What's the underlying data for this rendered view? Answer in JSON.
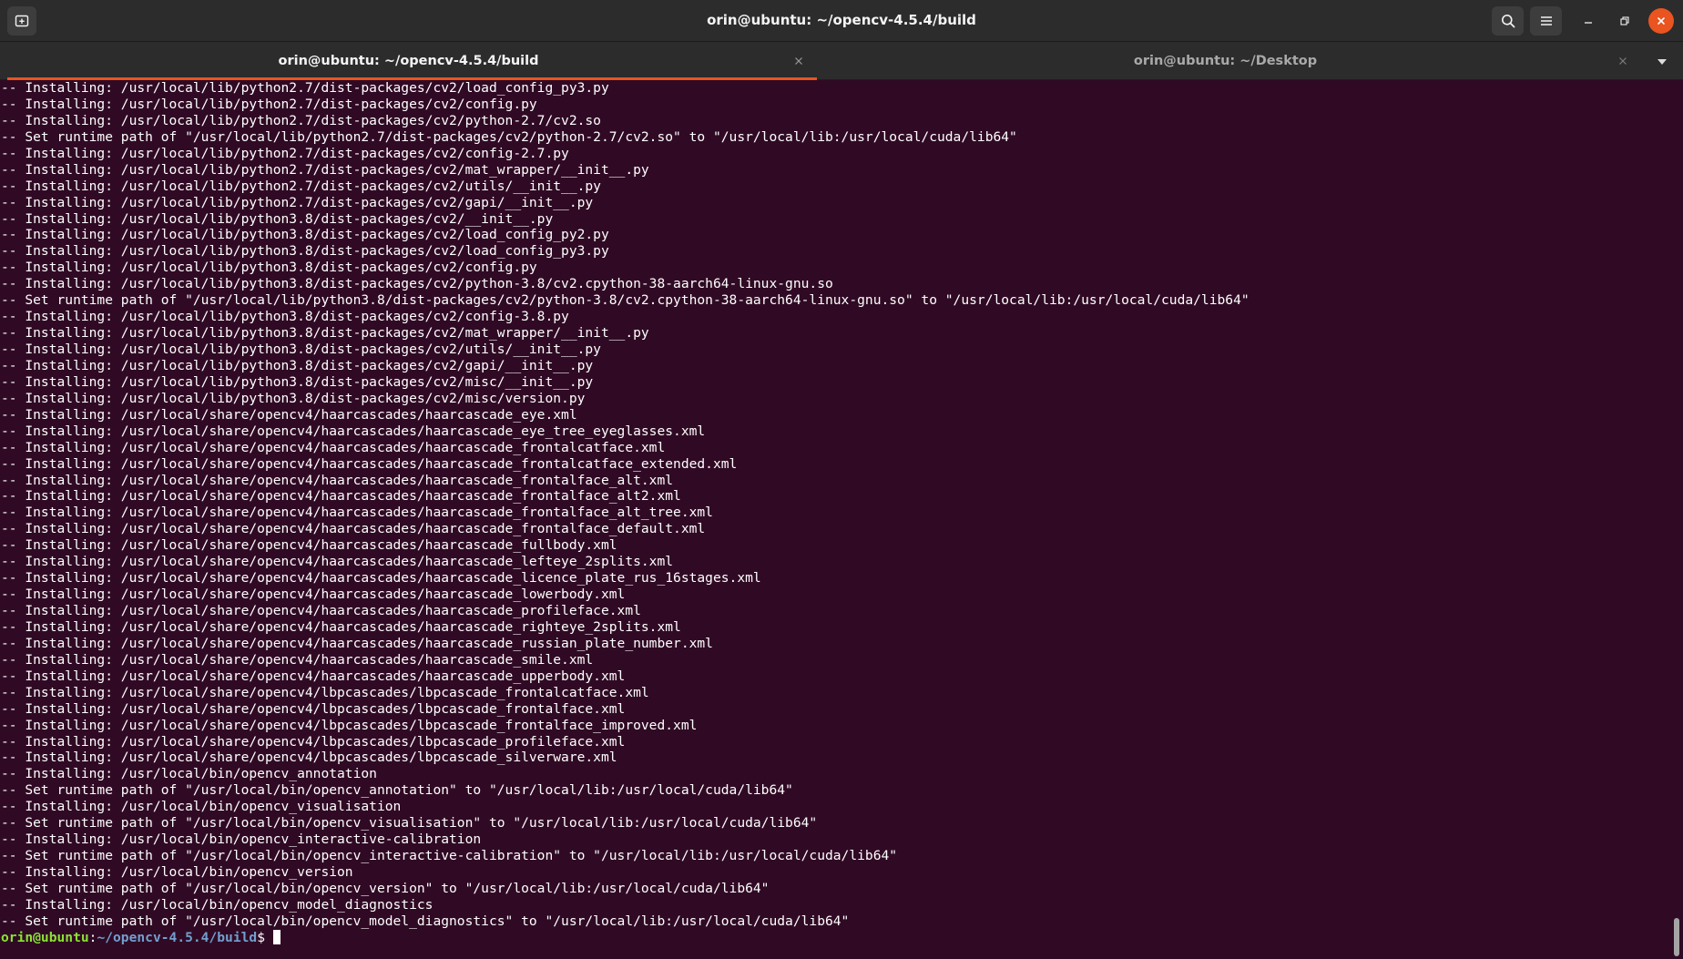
{
  "window": {
    "title": "orin@ubuntu: ~/opencv-4.5.4/build"
  },
  "headerbar": {
    "new_tab_icon": "new-tab-icon",
    "search_icon": "search-icon",
    "menu_icon": "hamburger-menu-icon",
    "minimize_icon": "minimize-icon",
    "maximize_icon": "maximize-icon",
    "close_icon": "close-icon"
  },
  "tabs": [
    {
      "label": "orin@ubuntu: ~/opencv-4.5.4/build",
      "active": true
    },
    {
      "label": "orin@ubuntu: ~/Desktop",
      "active": false
    }
  ],
  "colors": {
    "terminal_bg": "#300a24",
    "accent": "#e95420",
    "prompt_user": "#8ae234",
    "prompt_path": "#729fcf"
  },
  "terminal": {
    "lines": [
      "-- Installing: /usr/local/lib/python2.7/dist-packages/cv2/load_config_py3.py",
      "-- Installing: /usr/local/lib/python2.7/dist-packages/cv2/config.py",
      "-- Installing: /usr/local/lib/python2.7/dist-packages/cv2/python-2.7/cv2.so",
      "-- Set runtime path of \"/usr/local/lib/python2.7/dist-packages/cv2/python-2.7/cv2.so\" to \"/usr/local/lib:/usr/local/cuda/lib64\"",
      "-- Installing: /usr/local/lib/python2.7/dist-packages/cv2/config-2.7.py",
      "-- Installing: /usr/local/lib/python2.7/dist-packages/cv2/mat_wrapper/__init__.py",
      "-- Installing: /usr/local/lib/python2.7/dist-packages/cv2/utils/__init__.py",
      "-- Installing: /usr/local/lib/python2.7/dist-packages/cv2/gapi/__init__.py",
      "-- Installing: /usr/local/lib/python3.8/dist-packages/cv2/__init__.py",
      "-- Installing: /usr/local/lib/python3.8/dist-packages/cv2/load_config_py2.py",
      "-- Installing: /usr/local/lib/python3.8/dist-packages/cv2/load_config_py3.py",
      "-- Installing: /usr/local/lib/python3.8/dist-packages/cv2/config.py",
      "-- Installing: /usr/local/lib/python3.8/dist-packages/cv2/python-3.8/cv2.cpython-38-aarch64-linux-gnu.so",
      "-- Set runtime path of \"/usr/local/lib/python3.8/dist-packages/cv2/python-3.8/cv2.cpython-38-aarch64-linux-gnu.so\" to \"/usr/local/lib:/usr/local/cuda/lib64\"",
      "-- Installing: /usr/local/lib/python3.8/dist-packages/cv2/config-3.8.py",
      "-- Installing: /usr/local/lib/python3.8/dist-packages/cv2/mat_wrapper/__init__.py",
      "-- Installing: /usr/local/lib/python3.8/dist-packages/cv2/utils/__init__.py",
      "-- Installing: /usr/local/lib/python3.8/dist-packages/cv2/gapi/__init__.py",
      "-- Installing: /usr/local/lib/python3.8/dist-packages/cv2/misc/__init__.py",
      "-- Installing: /usr/local/lib/python3.8/dist-packages/cv2/misc/version.py",
      "-- Installing: /usr/local/share/opencv4/haarcascades/haarcascade_eye.xml",
      "-- Installing: /usr/local/share/opencv4/haarcascades/haarcascade_eye_tree_eyeglasses.xml",
      "-- Installing: /usr/local/share/opencv4/haarcascades/haarcascade_frontalcatface.xml",
      "-- Installing: /usr/local/share/opencv4/haarcascades/haarcascade_frontalcatface_extended.xml",
      "-- Installing: /usr/local/share/opencv4/haarcascades/haarcascade_frontalface_alt.xml",
      "-- Installing: /usr/local/share/opencv4/haarcascades/haarcascade_frontalface_alt2.xml",
      "-- Installing: /usr/local/share/opencv4/haarcascades/haarcascade_frontalface_alt_tree.xml",
      "-- Installing: /usr/local/share/opencv4/haarcascades/haarcascade_frontalface_default.xml",
      "-- Installing: /usr/local/share/opencv4/haarcascades/haarcascade_fullbody.xml",
      "-- Installing: /usr/local/share/opencv4/haarcascades/haarcascade_lefteye_2splits.xml",
      "-- Installing: /usr/local/share/opencv4/haarcascades/haarcascade_licence_plate_rus_16stages.xml",
      "-- Installing: /usr/local/share/opencv4/haarcascades/haarcascade_lowerbody.xml",
      "-- Installing: /usr/local/share/opencv4/haarcascades/haarcascade_profileface.xml",
      "-- Installing: /usr/local/share/opencv4/haarcascades/haarcascade_righteye_2splits.xml",
      "-- Installing: /usr/local/share/opencv4/haarcascades/haarcascade_russian_plate_number.xml",
      "-- Installing: /usr/local/share/opencv4/haarcascades/haarcascade_smile.xml",
      "-- Installing: /usr/local/share/opencv4/haarcascades/haarcascade_upperbody.xml",
      "-- Installing: /usr/local/share/opencv4/lbpcascades/lbpcascade_frontalcatface.xml",
      "-- Installing: /usr/local/share/opencv4/lbpcascades/lbpcascade_frontalface.xml",
      "-- Installing: /usr/local/share/opencv4/lbpcascades/lbpcascade_frontalface_improved.xml",
      "-- Installing: /usr/local/share/opencv4/lbpcascades/lbpcascade_profileface.xml",
      "-- Installing: /usr/local/share/opencv4/lbpcascades/lbpcascade_silverware.xml",
      "-- Installing: /usr/local/bin/opencv_annotation",
      "-- Set runtime path of \"/usr/local/bin/opencv_annotation\" to \"/usr/local/lib:/usr/local/cuda/lib64\"",
      "-- Installing: /usr/local/bin/opencv_visualisation",
      "-- Set runtime path of \"/usr/local/bin/opencv_visualisation\" to \"/usr/local/lib:/usr/local/cuda/lib64\"",
      "-- Installing: /usr/local/bin/opencv_interactive-calibration",
      "-- Set runtime path of \"/usr/local/bin/opencv_interactive-calibration\" to \"/usr/local/lib:/usr/local/cuda/lib64\"",
      "-- Installing: /usr/local/bin/opencv_version",
      "-- Set runtime path of \"/usr/local/bin/opencv_version\" to \"/usr/local/lib:/usr/local/cuda/lib64\"",
      "-- Installing: /usr/local/bin/opencv_model_diagnostics",
      "-- Set runtime path of \"/usr/local/bin/opencv_model_diagnostics\" to \"/usr/local/lib:/usr/local/cuda/lib64\""
    ],
    "prompt": {
      "user_host": "orin@ubuntu",
      "separator": ":",
      "path": "~/opencv-4.5.4/build",
      "symbol": "$ "
    }
  }
}
